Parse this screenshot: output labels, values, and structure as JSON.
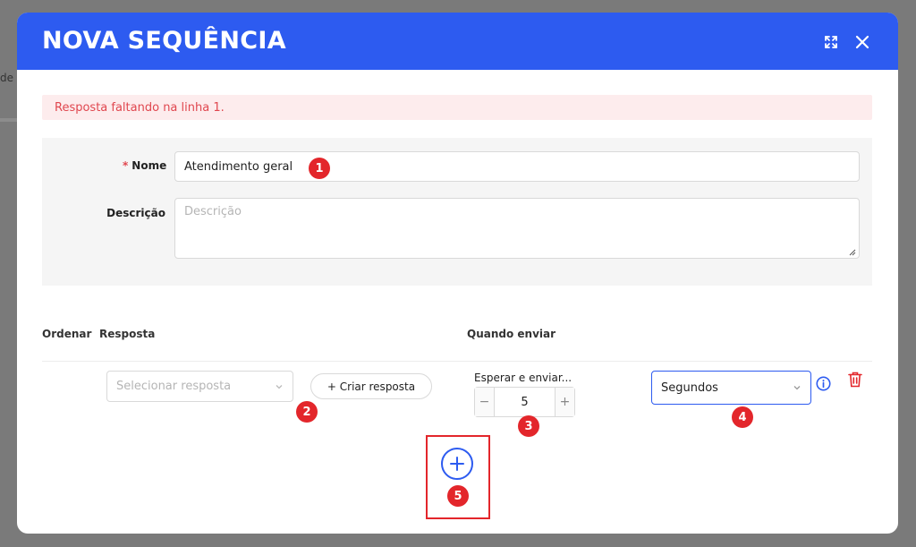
{
  "background": {
    "side_text": "de"
  },
  "modal": {
    "title": "NOVA SEQUÊNCIA",
    "expand_icon": "expand-icon",
    "close_icon": "close-icon",
    "header_color": "#2d5bf0"
  },
  "alert": {
    "text": "Resposta faltando na linha 1.",
    "color": "#e0474f"
  },
  "form": {
    "name_label": "Nome",
    "required_mark": "*",
    "name_value": "Atendimento geral",
    "description_label": "Descrição",
    "description_placeholder": "Descrição"
  },
  "columns": {
    "order": "Ordenar",
    "response": "Resposta",
    "when_send": "Quando enviar"
  },
  "row": {
    "response_placeholder": "Selecionar resposta",
    "create_button": "+ Criar resposta",
    "wait_label": "Esperar e enviar...",
    "minus": "−",
    "wait_value": "5",
    "plus": "+",
    "unit_selected": "Segundos",
    "info_icon": "info-icon",
    "delete_icon": "trash-icon"
  },
  "add_row_icon": "plus-circle-icon",
  "markers": [
    "1",
    "2",
    "3",
    "4",
    "5"
  ]
}
